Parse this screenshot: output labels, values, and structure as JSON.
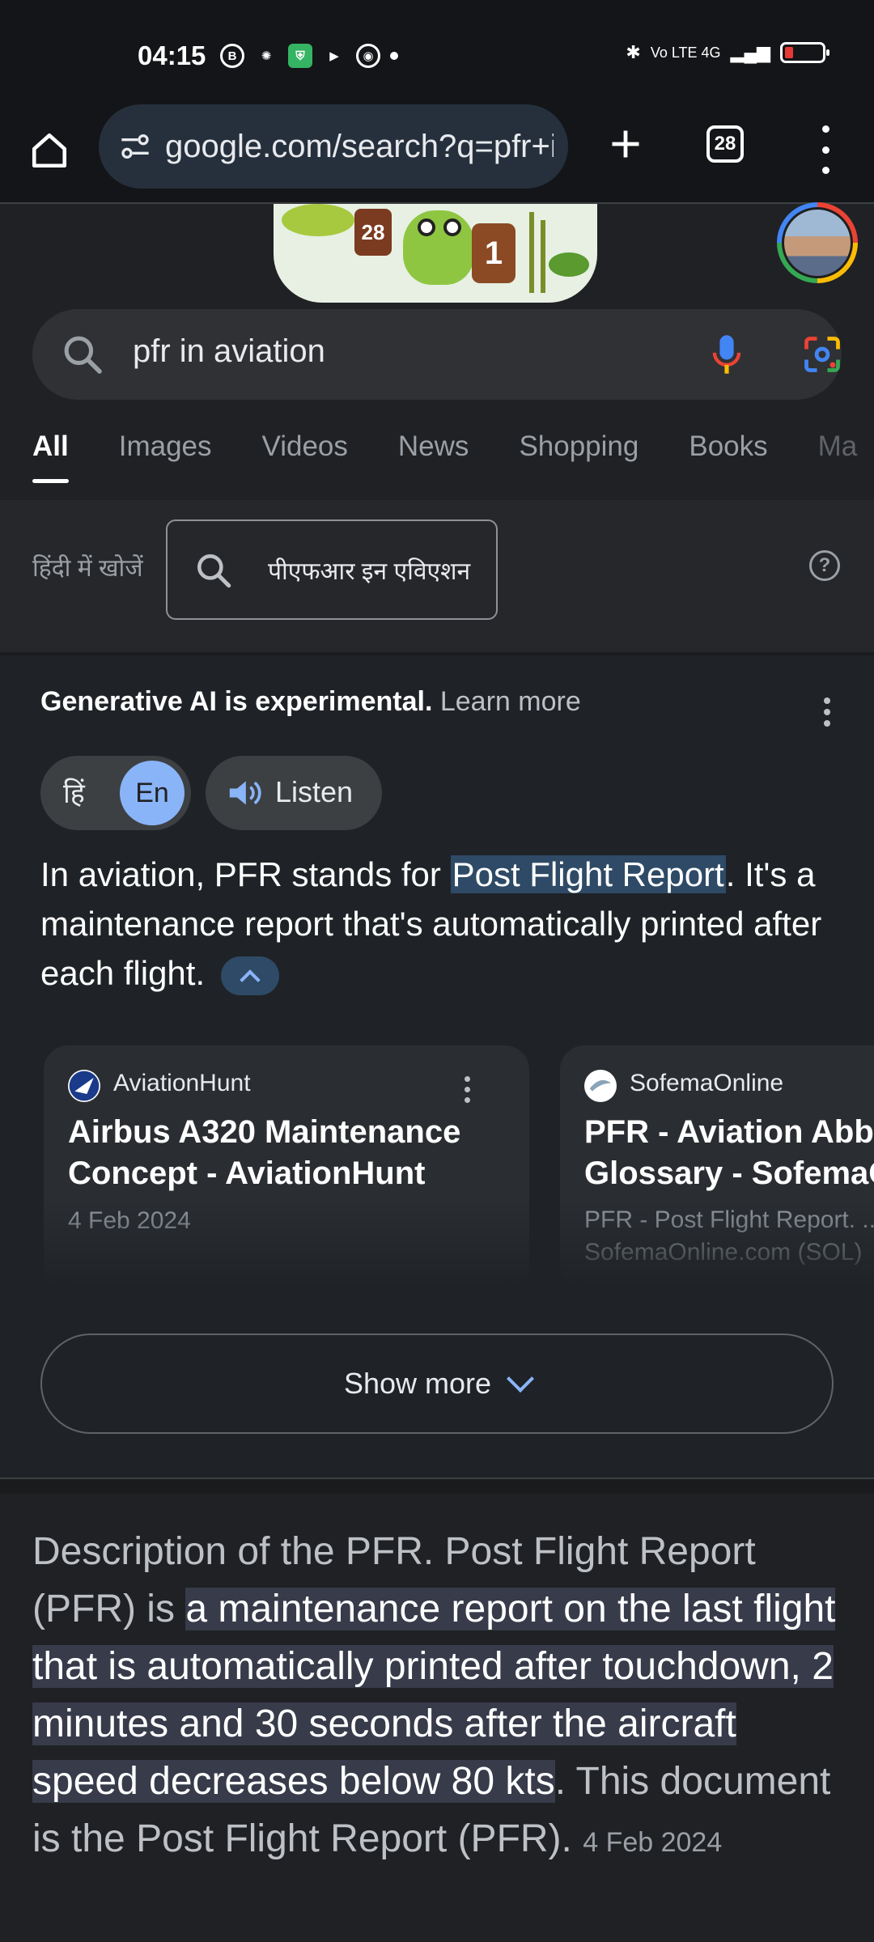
{
  "status_bar": {
    "time": "04:15",
    "icons": [
      "b-circle-icon",
      "bug-icon",
      "shield-icon",
      "play-icon",
      "chrome-icon"
    ],
    "network": "Vo LTE 4G",
    "battery_color": "#e53935"
  },
  "toolbar": {
    "url": "google.com/search?q=pfr+in+aviation",
    "tab_count": "28"
  },
  "search": {
    "query": "pfr in aviation"
  },
  "tabs": [
    "All",
    "Images",
    "Videos",
    "News",
    "Shopping",
    "Books",
    "Ma"
  ],
  "hindi": {
    "label": "हिंदी में खोजें",
    "chip": "पीएफआर इन एविएशन",
    "help": "?"
  },
  "ai_overview": {
    "heading": "Generative AI is experimental.",
    "learn_more": "Learn more",
    "lang_hi": "हिं",
    "lang_en": "En",
    "listen": "Listen",
    "text_before": "In aviation, PFR stands for ",
    "text_highlight": "Post Flight Report",
    "text_after": ". It's a maintenance report that's automatically printed after each flight.",
    "sources": [
      {
        "site": "AviationHunt",
        "title_line1": "Airbus A320 Maintenance",
        "title_line2": "Concept - AviationHunt",
        "date": "4 Feb 2024"
      },
      {
        "site": "SofemaOnline",
        "title_line1": "PFR - Aviation Abbr",
        "title_line2": "Glossary - SofemaO",
        "snippet_line1": "PFR - Post Flight Report. ...",
        "snippet_line2": "SofemaOnline.com (SOL)"
      }
    ],
    "show_more": "Show more"
  },
  "featured_snippet": {
    "lead": "Description of the PFR. Post Flight Report (PFR) is ",
    "highlight": "a maintenance report on the last flight that is automatically printed after touchdown, 2 minutes and 30 seconds after the aircraft speed decreases below 80 kts",
    "tail": ". This document is the Post Flight Report (PFR).",
    "date": "4 Feb 2024"
  },
  "colors": {
    "background": "#202124",
    "accent_blue": "#8ab4f8",
    "highlight_bg": "#2e4a66"
  }
}
